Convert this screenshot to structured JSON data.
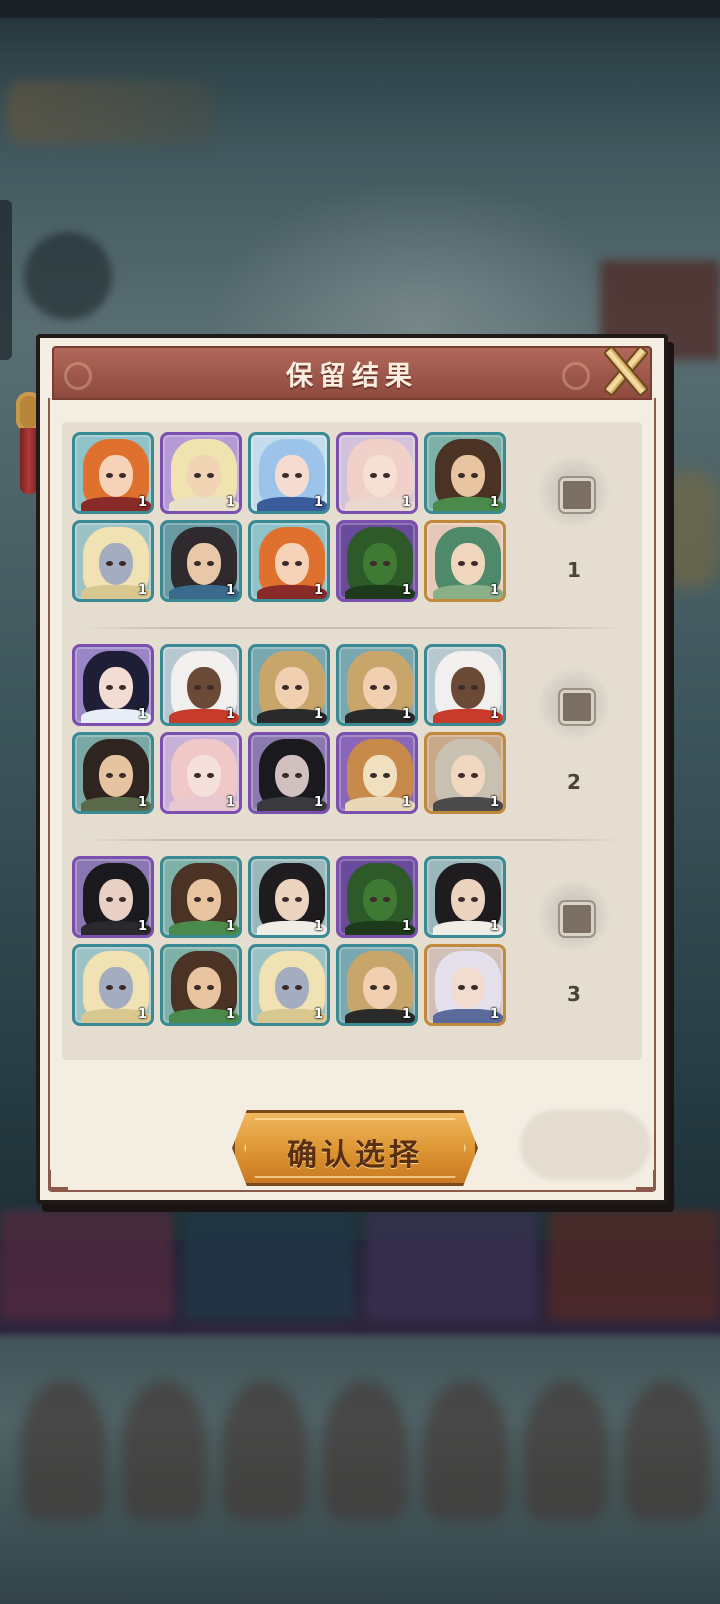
{
  "dialog": {
    "title": "保留结果",
    "confirm_label": "确认选择"
  },
  "colors": {
    "frame_teal": "#3a8a94",
    "frame_purple": "#7a4fb0",
    "frame_gold": "#c0893b",
    "header": "#a35d4f",
    "panel": "#f3ede2",
    "button": "#dc9431"
  },
  "groups": [
    {
      "number": "1",
      "heroes": [
        {
          "level": "1",
          "rarity": "teal",
          "hair": "#e0702e",
          "skin": "#f5d2b8",
          "outfit": "#8a2a28",
          "bg": "#8fc3c9"
        },
        {
          "level": "1",
          "rarity": "purple",
          "hair": "#efe3b0",
          "skin": "#f0d4b4",
          "outfit": "#e8e0c8",
          "bg": "#b59ad6"
        },
        {
          "level": "1",
          "rarity": "teal",
          "hair": "#9cc4ea",
          "skin": "#f6dcd0",
          "outfit": "#3a5c9c",
          "bg": "#c4dcec"
        },
        {
          "level": "1",
          "rarity": "purple",
          "hair": "#f0d0c8",
          "skin": "#f6e0d6",
          "outfit": "#e8d8d0",
          "bg": "#d2c2dc"
        },
        {
          "level": "1",
          "rarity": "teal",
          "hair": "#4a3224",
          "skin": "#e8c4a0",
          "outfit": "#4a8a4a",
          "bg": "#7eb0a8"
        },
        {
          "level": "1",
          "rarity": "teal",
          "hair": "#f1e2b4",
          "skin": "#a4acc0",
          "outfit": "#d8c890",
          "bg": "#9cc2c6"
        },
        {
          "level": "1",
          "rarity": "teal",
          "hair": "#2e2a2e",
          "skin": "#e8c8a8",
          "outfit": "#3a6a8c",
          "bg": "#6a9aa4"
        },
        {
          "level": "1",
          "rarity": "teal",
          "hair": "#e0702e",
          "skin": "#f5d2b8",
          "outfit": "#8a2a28",
          "bg": "#8fc3c9"
        },
        {
          "level": "1",
          "rarity": "purple",
          "hair": "#2e5a2a",
          "skin": "#3e7a34",
          "outfit": "#1e3a1c",
          "bg": "#6a4a9a"
        },
        {
          "level": "1",
          "rarity": "gold",
          "hair": "#4e8a6a",
          "skin": "#f0d6bc",
          "outfit": "#8ab08a",
          "bg": "#e6c8b8"
        }
      ]
    },
    {
      "number": "2",
      "heroes": [
        {
          "level": "1",
          "rarity": "purple",
          "hair": "#1e1e36",
          "skin": "#f2dcd4",
          "outfit": "#e8eef6",
          "bg": "#9a86c6"
        },
        {
          "level": "1",
          "rarity": "teal",
          "hair": "#f2f0ee",
          "skin": "#6a4a36",
          "outfit": "#c83a2a",
          "bg": "#b8c8d0"
        },
        {
          "level": "1",
          "rarity": "teal",
          "hair": "#c8a56a",
          "skin": "#f0d0b0",
          "outfit": "#2a2a2a",
          "bg": "#7aa8b0"
        },
        {
          "level": "1",
          "rarity": "teal",
          "hair": "#c8a56a",
          "skin": "#f0d0b0",
          "outfit": "#2a2a2a",
          "bg": "#7aa8b0"
        },
        {
          "level": "1",
          "rarity": "teal",
          "hair": "#f2f0ee",
          "skin": "#6a4a36",
          "outfit": "#c83a2a",
          "bg": "#b8c8d0"
        },
        {
          "level": "1",
          "rarity": "teal",
          "hair": "#2e2420",
          "skin": "#e6c4a2",
          "outfit": "#5a6a4a",
          "bg": "#7aa8a4"
        },
        {
          "level": "1",
          "rarity": "purple",
          "hair": "#f0c8c8",
          "skin": "#f6e0dc",
          "outfit": "#e8c8d0",
          "bg": "#c8b0d8"
        },
        {
          "level": "1",
          "rarity": "purple",
          "hair": "#1a1a1e",
          "skin": "#d0c0c0",
          "outfit": "#3a3a3e",
          "bg": "#8a7ab0"
        },
        {
          "level": "1",
          "rarity": "purple",
          "hair": "#c88a4a",
          "skin": "#f0e0c0",
          "outfit": "#e8d8b8",
          "bg": "#8a66b8"
        },
        {
          "level": "1",
          "rarity": "gold",
          "hair": "#c8c0b0",
          "skin": "#f0d8c0",
          "outfit": "#4a4a4a",
          "bg": "#c8a888"
        }
      ]
    },
    {
      "number": "3",
      "heroes": [
        {
          "level": "1",
          "rarity": "purple",
          "hair": "#1a1a1e",
          "skin": "#e8d0c4",
          "outfit": "#2a2a2e",
          "bg": "#8a76b0"
        },
        {
          "level": "1",
          "rarity": "teal",
          "hair": "#4a3224",
          "skin": "#e8c4a0",
          "outfit": "#4a8a4a",
          "bg": "#7eb0a8"
        },
        {
          "level": "1",
          "rarity": "teal",
          "hair": "#1e1c1e",
          "skin": "#ecd4c0",
          "outfit": "#f0ece6",
          "bg": "#9ab8bc"
        },
        {
          "level": "1",
          "rarity": "purple",
          "hair": "#2e5a2a",
          "skin": "#3e7a34",
          "outfit": "#1e3a1c",
          "bg": "#6a4a9a"
        },
        {
          "level": "1",
          "rarity": "teal",
          "hair": "#1e1c1e",
          "skin": "#ecd4c0",
          "outfit": "#f0ece6",
          "bg": "#9ab8bc"
        },
        {
          "level": "1",
          "rarity": "teal",
          "hair": "#f1e2b4",
          "skin": "#a4acc0",
          "outfit": "#d8c890",
          "bg": "#9cc2c6"
        },
        {
          "level": "1",
          "rarity": "teal",
          "hair": "#4a3224",
          "skin": "#e8c4a0",
          "outfit": "#4a8a4a",
          "bg": "#7eb0a8"
        },
        {
          "level": "1",
          "rarity": "teal",
          "hair": "#f1e2b4",
          "skin": "#a4acc0",
          "outfit": "#d8c890",
          "bg": "#9cc2c6"
        },
        {
          "level": "1",
          "rarity": "teal",
          "hair": "#c8a56a",
          "skin": "#f0d0b0",
          "outfit": "#2a2a2a",
          "bg": "#7aa8b0"
        },
        {
          "level": "1",
          "rarity": "gold",
          "hair": "#e4e0ec",
          "skin": "#f2dcd0",
          "outfit": "#5a6a9a",
          "bg": "#d0c0b8"
        }
      ]
    }
  ]
}
